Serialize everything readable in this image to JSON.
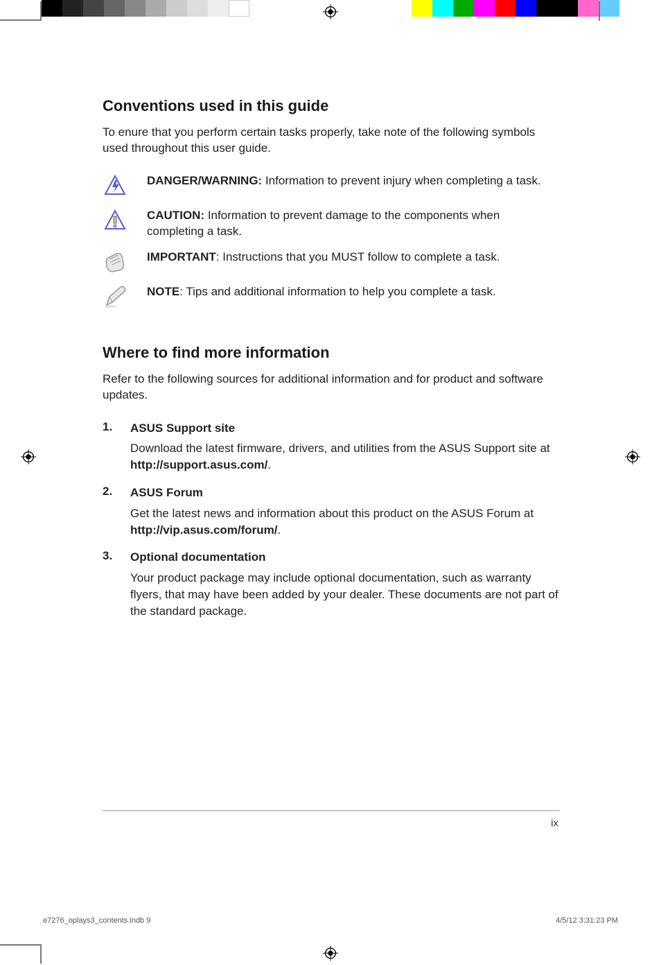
{
  "section1": {
    "heading": "Conventions used in this guide",
    "intro": "To enure that you perform certain tasks properly, take note of the following symbols used throughout this user guide.",
    "items": [
      {
        "label": "DANGER/WARNING:",
        "text": " Information to prevent injury when completing a task."
      },
      {
        "label": "CAUTION:",
        "text": " Information to prevent damage to the components when completing a task."
      },
      {
        "label": "IMPORTANT",
        "text": ": Instructions that you MUST follow to complete a task."
      },
      {
        "label": "NOTE",
        "text": ": Tips and additional information to help you complete a task."
      }
    ]
  },
  "section2": {
    "heading": "Where to find more information",
    "intro": "Refer to the following sources for additional information and for product and software updates.",
    "sources": [
      {
        "title": "ASUS Support site",
        "body_pre": "Download the latest firmware, drivers, and utilities from the ASUS Support site at ",
        "body_bold": "http://support.asus.com/",
        "body_post": "."
      },
      {
        "title": "ASUS Forum",
        "body_pre": "Get the latest news and information about this product on the ASUS Forum at ",
        "body_bold": "http://vip.asus.com/forum/",
        "body_post": "."
      },
      {
        "title": "Optional documentation",
        "body_pre": "Your product package may include optional documentation, such as warranty flyers, that may have been added by your dealer. These documents are not part of the standard package.",
        "body_bold": "",
        "body_post": ""
      }
    ]
  },
  "footer": {
    "page_number": "ix",
    "file_info": "e7276_oplays3_contents.indb   9",
    "timestamp": "4/5/12   3:31:23 PM"
  }
}
